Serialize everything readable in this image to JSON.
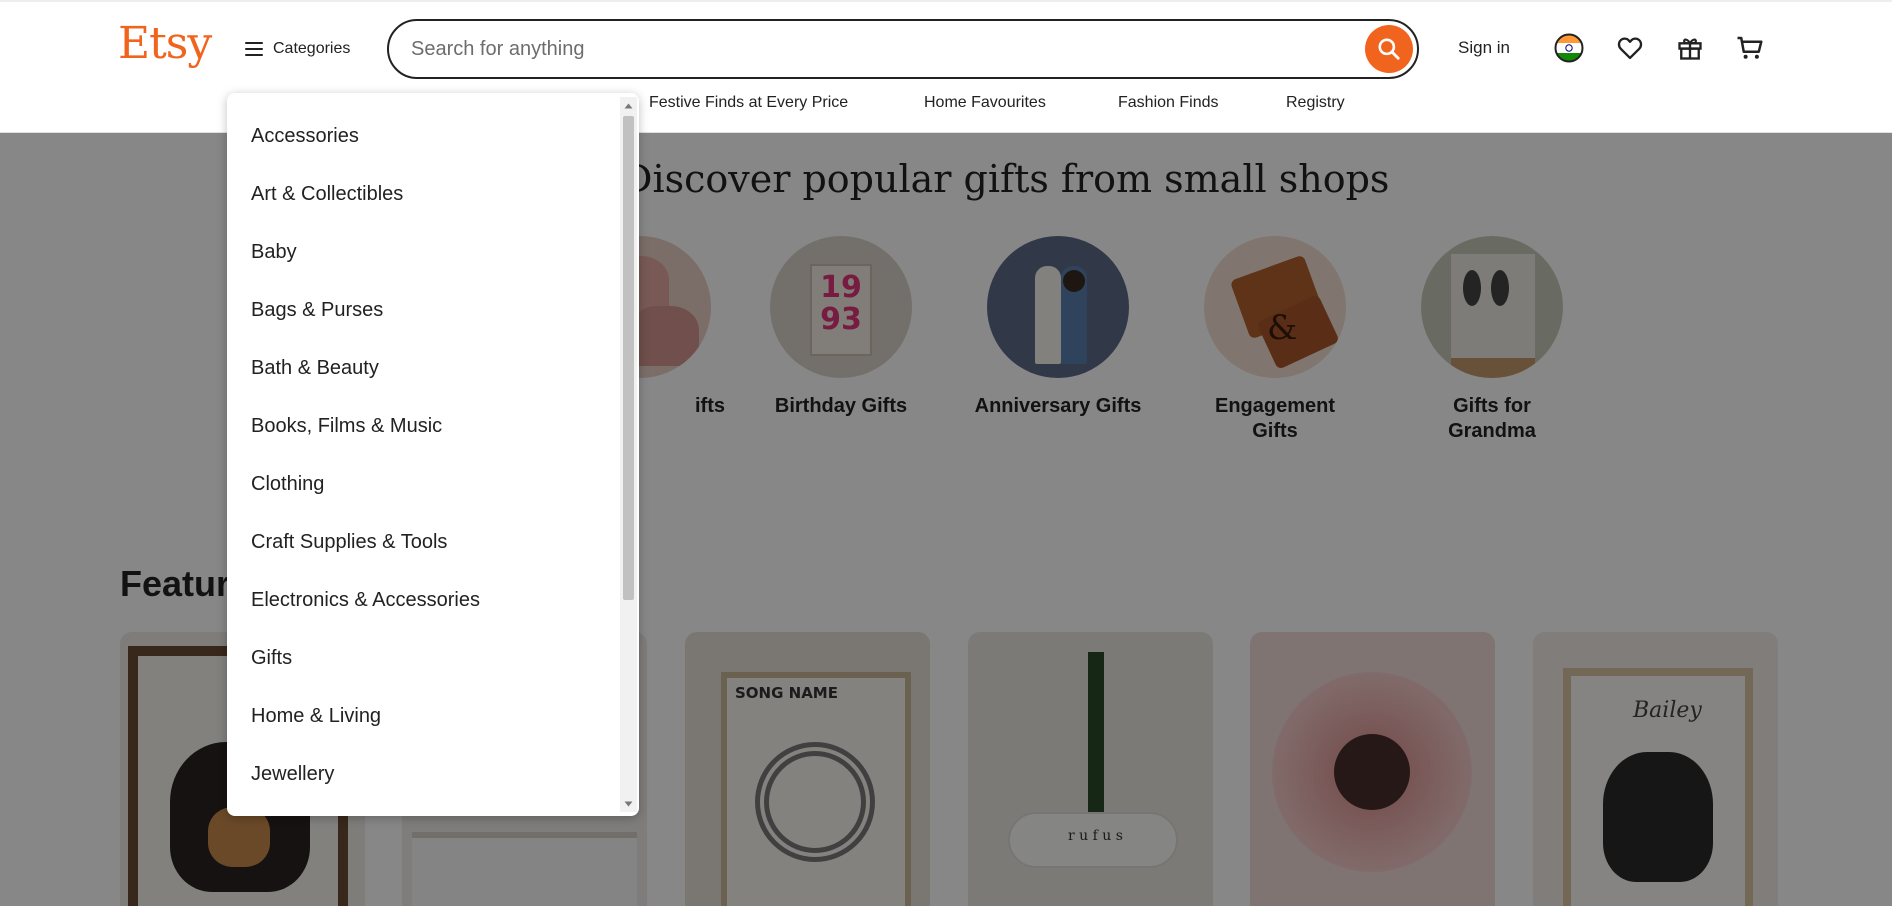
{
  "header": {
    "logo": "Etsy",
    "categories_label": "Categories",
    "search_placeholder": "Search for anything",
    "sign_in": "Sign in",
    "subnav": [
      "Festive Finds at Every Price",
      "Home Favourites",
      "Fashion Finds",
      "Registry"
    ],
    "icons": [
      "india-flag-icon",
      "heart-icon",
      "gift-icon",
      "cart-icon"
    ],
    "accent_color": "#f1641e"
  },
  "main": {
    "discover_title": "Discover popular gifts from small shops",
    "gift_circles": [
      {
        "label": "ifts"
      },
      {
        "label": "Birthday Gifts"
      },
      {
        "label": "Anniversary Gifts"
      },
      {
        "label": "Engagement Gifts"
      },
      {
        "label": "Gifts for Grandma"
      }
    ],
    "featured_title": "Featur",
    "card_texts": {
      "song_name": "SONG NAME",
      "rufus": "r u f u s",
      "bailey": "Bailey"
    }
  },
  "categories_menu": {
    "items": [
      "Accessories",
      "Art & Collectibles",
      "Baby",
      "Bags & Purses",
      "Bath & Beauty",
      "Books, Films & Music",
      "Clothing",
      "Craft Supplies & Tools",
      "Electronics & Accessories",
      "Gifts",
      "Home & Living",
      "Jewellery"
    ]
  }
}
